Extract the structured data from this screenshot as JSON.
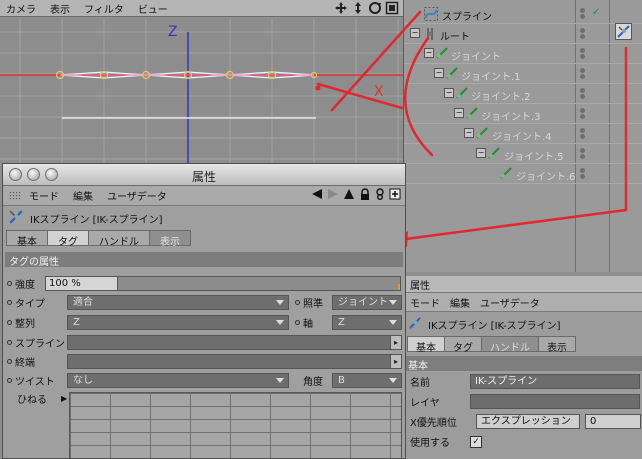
{
  "viewport": {
    "menu": [
      "カメラ",
      "表示",
      "フィルタ",
      "ビュー"
    ],
    "axis_z": "Z",
    "axis_x": "X"
  },
  "object_manager": {
    "items": [
      {
        "label": "スプライン",
        "depth": 0,
        "dim": false
      },
      {
        "label": "ルート",
        "depth": 0,
        "dim": false
      },
      {
        "label": "ジョイント",
        "depth": 1,
        "dim": true
      },
      {
        "label": "ジョイント.1",
        "depth": 2,
        "dim": true
      },
      {
        "label": "ジョイント.2",
        "depth": 3,
        "dim": true
      },
      {
        "label": "ジョイント.3",
        "depth": 4,
        "dim": true
      },
      {
        "label": "ジョイント.4",
        "depth": 5,
        "dim": true
      },
      {
        "label": "ジョイント.5",
        "depth": 6,
        "dim": true
      },
      {
        "label": "ジョイント.6",
        "depth": 7,
        "dim": true
      }
    ]
  },
  "attr_window": {
    "title": "属性",
    "menu": [
      "モード",
      "編集",
      "ユーザデータ"
    ],
    "object_header": "IKスプライン [IK-スプライン]",
    "tabs": [
      {
        "label": "基本",
        "state": "normal"
      },
      {
        "label": "タグ",
        "state": "active"
      },
      {
        "label": "ハンドル",
        "state": "normal"
      },
      {
        "label": "表示",
        "state": "ghost"
      }
    ],
    "section": "タグの属性",
    "strength_label": "強度",
    "strength_value": "100 %",
    "strength_fraction": 1.0,
    "type_label": "タイプ",
    "type_value": "適合",
    "aim_label": "照準",
    "aim_value": "ジョイント",
    "align_label": "整列",
    "align_value": "Z",
    "axis_label": "軸",
    "axis_value": "Z",
    "spline_label": "スプライン",
    "end_label": "終端",
    "twist_label": "ツイスト",
    "twist_value": "なし",
    "angle_label": "角度",
    "angle_value": "B",
    "twist_graph_label": "ひねる"
  },
  "attr_panel": {
    "title": "属性",
    "menu": [
      "モード",
      "編集",
      "ユーザデータ"
    ],
    "object_header": "IKスプライン [IK-スプライン]",
    "tabs": [
      {
        "label": "基本",
        "state": "active"
      },
      {
        "label": "タグ",
        "state": "normal"
      },
      {
        "label": "ハンドル",
        "state": "ghost"
      },
      {
        "label": "表示",
        "state": "normal"
      }
    ],
    "section": "基本",
    "name_label": "名前",
    "name_value": "IK-スプライン",
    "layer_label": "レイヤ",
    "priority_label": "X優先順位",
    "priority_value": "エクスプレッション",
    "priority_number": "0",
    "enabled_label": "使用する",
    "enabled_checked": true
  },
  "colors": {
    "annotation_red": "#e0282e",
    "axis_x": "#d7322e",
    "axis_z": "#2f36c4"
  }
}
